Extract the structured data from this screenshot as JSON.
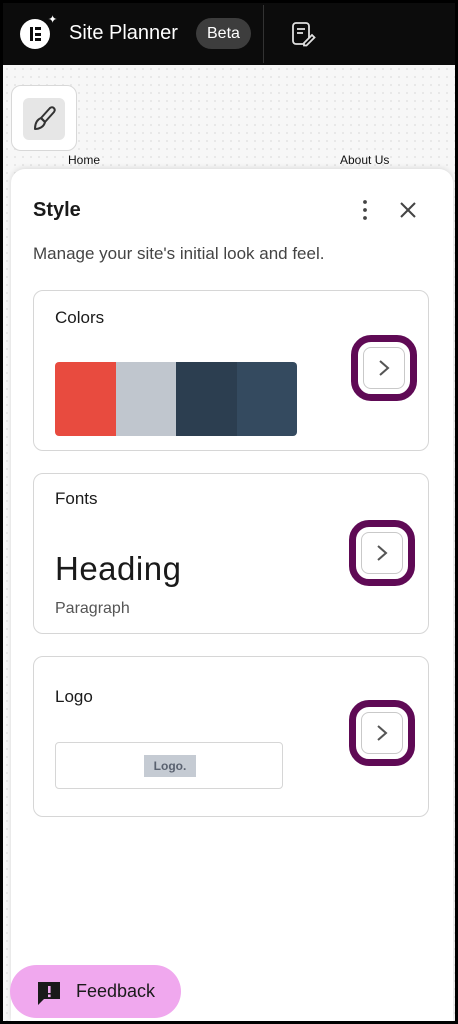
{
  "topbar": {
    "app_title": "Site Planner",
    "badge": "Beta",
    "logo_icon": "elementor-logo-icon",
    "notes_icon": "notes-edit-icon"
  },
  "canvas": {
    "pages": [
      {
        "label": "Home"
      },
      {
        "label": "About Us"
      }
    ],
    "style_icon": "brush-icon"
  },
  "panel": {
    "title": "Style",
    "subtitle": "Manage your site's initial look and feel.",
    "more_icon": "more-vertical-icon",
    "close_icon": "close-icon",
    "sections": {
      "colors": {
        "title": "Colors",
        "swatches": [
          "#e84b3f",
          "#c0c6ce",
          "#2c3e50",
          "#344a5f"
        ]
      },
      "fonts": {
        "title": "Fonts",
        "heading_sample": "Heading",
        "paragraph_sample": "Paragraph"
      },
      "logo": {
        "title": "Logo",
        "placeholder": "Logo."
      }
    },
    "highlight_color": "#5f0a55"
  },
  "feedback": {
    "label": "Feedback",
    "icon": "feedback-icon",
    "color": "#f0a8ee"
  }
}
